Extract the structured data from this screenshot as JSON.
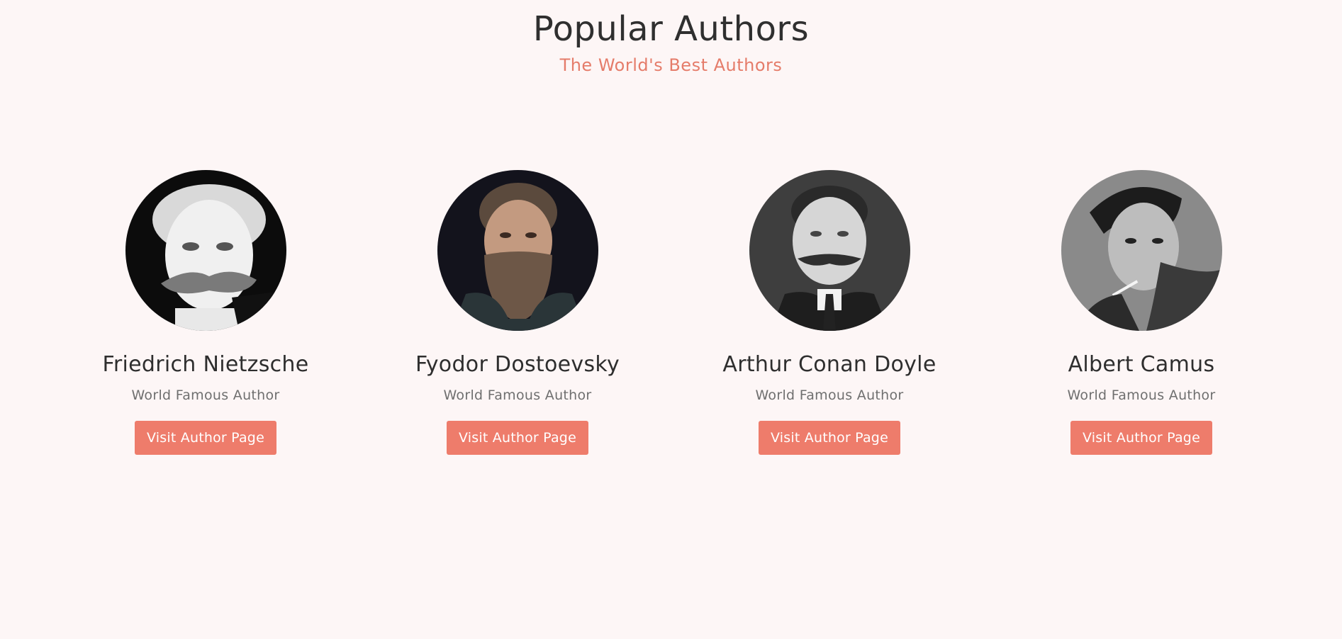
{
  "header": {
    "title": "Popular Authors",
    "subtitle": "The World's Best Authors"
  },
  "authors": [
    {
      "name": "Friedrich Nietzsche",
      "role": "World Famous Author",
      "button_label": "Visit Author Page",
      "photo": "friedrich-nietzsche-portrait"
    },
    {
      "name": "Fyodor Dostoevsky",
      "role": "World Famous Author",
      "button_label": "Visit Author Page",
      "photo": "fyodor-dostoevsky-portrait"
    },
    {
      "name": "Arthur Conan Doyle",
      "role": "World Famous Author",
      "button_label": "Visit Author Page",
      "photo": "arthur-conan-doyle-portrait"
    },
    {
      "name": "Albert Camus",
      "role": "World Famous Author",
      "button_label": "Visit Author Page",
      "photo": "albert-camus-portrait"
    }
  ],
  "colors": {
    "background": "#fdf6f6",
    "accent": "#ee7c6b",
    "subtitle": "#e57c6a",
    "heading": "#2e2e2e",
    "muted": "#6f6f6f"
  }
}
